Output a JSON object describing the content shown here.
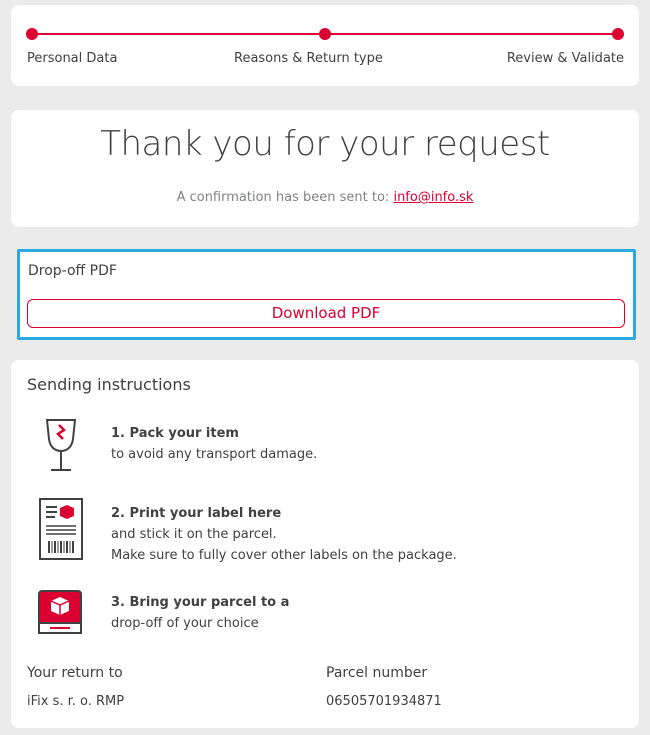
{
  "stepper": {
    "steps": [
      "Personal Data",
      "Reasons & Return type",
      "Review & Validate"
    ],
    "color": "#dc0032"
  },
  "thanks": {
    "title": "Thank you for your request",
    "confirm_text": "A confirmation has been sent to:",
    "email": "info@info.sk"
  },
  "dropoff": {
    "label": "Drop-off PDF",
    "button": "Download PDF",
    "highlight_color": "#29a9e0"
  },
  "instructions": {
    "heading": "Sending instructions",
    "items": [
      {
        "icon": "fragile-glass-icon",
        "title": "1. Pack your item",
        "lines": [
          "to avoid any transport damage."
        ]
      },
      {
        "icon": "shipping-label-icon",
        "title": "2. Print your label here",
        "lines": [
          "and stick it on the parcel.",
          "Make sure to fully cover other labels on the package."
        ]
      },
      {
        "icon": "parcel-shop-icon",
        "title": "3. Bring your parcel to a",
        "lines": [
          "drop-off of your choice"
        ]
      }
    ],
    "return_to_label": "Your return to",
    "return_to_value": "iFix s. r. o. RMP",
    "parcel_label": "Parcel number",
    "parcel_value": "06505701934871"
  }
}
